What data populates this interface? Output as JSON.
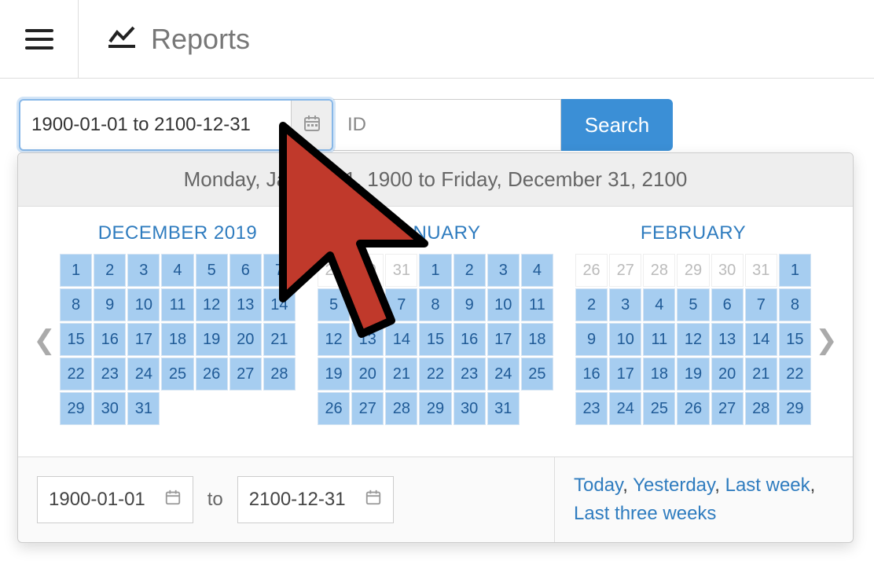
{
  "header": {
    "title": "Reports"
  },
  "search": {
    "daterange_value": "1900-01-01 to 2100-12-31",
    "id_placeholder": "ID",
    "button_label": "Search"
  },
  "datepicker": {
    "range_text": "Monday, January 1, 1900 to Friday, December 31, 2100",
    "months": [
      {
        "title": "DECEMBER 2019",
        "days": [
          {
            "n": "1",
            "in": true
          },
          {
            "n": "2",
            "in": true
          },
          {
            "n": "3",
            "in": true
          },
          {
            "n": "4",
            "in": true
          },
          {
            "n": "5",
            "in": true
          },
          {
            "n": "6",
            "in": true
          },
          {
            "n": "7",
            "in": true
          },
          {
            "n": "8",
            "in": true
          },
          {
            "n": "9",
            "in": true
          },
          {
            "n": "10",
            "in": true
          },
          {
            "n": "11",
            "in": true
          },
          {
            "n": "12",
            "in": true
          },
          {
            "n": "13",
            "in": true
          },
          {
            "n": "14",
            "in": true
          },
          {
            "n": "15",
            "in": true
          },
          {
            "n": "16",
            "in": true
          },
          {
            "n": "17",
            "in": true
          },
          {
            "n": "18",
            "in": true
          },
          {
            "n": "19",
            "in": true
          },
          {
            "n": "20",
            "in": true
          },
          {
            "n": "21",
            "in": true
          },
          {
            "n": "22",
            "in": true
          },
          {
            "n": "23",
            "in": true
          },
          {
            "n": "24",
            "in": true
          },
          {
            "n": "25",
            "in": true
          },
          {
            "n": "26",
            "in": true
          },
          {
            "n": "27",
            "in": true
          },
          {
            "n": "28",
            "in": true
          },
          {
            "n": "29",
            "in": true
          },
          {
            "n": "30",
            "in": true
          },
          {
            "n": "31",
            "in": true
          }
        ]
      },
      {
        "title": "JANUARY",
        "days": [
          {
            "n": "29",
            "in": false
          },
          {
            "n": "30",
            "in": false
          },
          {
            "n": "31",
            "in": false
          },
          {
            "n": "1",
            "in": true
          },
          {
            "n": "2",
            "in": true
          },
          {
            "n": "3",
            "in": true
          },
          {
            "n": "4",
            "in": true
          },
          {
            "n": "5",
            "in": true
          },
          {
            "n": "6",
            "in": true
          },
          {
            "n": "7",
            "in": true
          },
          {
            "n": "8",
            "in": true
          },
          {
            "n": "9",
            "in": true
          },
          {
            "n": "10",
            "in": true
          },
          {
            "n": "11",
            "in": true
          },
          {
            "n": "12",
            "in": true
          },
          {
            "n": "13",
            "in": true
          },
          {
            "n": "14",
            "in": true
          },
          {
            "n": "15",
            "in": true
          },
          {
            "n": "16",
            "in": true
          },
          {
            "n": "17",
            "in": true
          },
          {
            "n": "18",
            "in": true
          },
          {
            "n": "19",
            "in": true
          },
          {
            "n": "20",
            "in": true
          },
          {
            "n": "21",
            "in": true
          },
          {
            "n": "22",
            "in": true
          },
          {
            "n": "23",
            "in": true
          },
          {
            "n": "24",
            "in": true
          },
          {
            "n": "25",
            "in": true
          },
          {
            "n": "26",
            "in": true
          },
          {
            "n": "27",
            "in": true
          },
          {
            "n": "28",
            "in": true
          },
          {
            "n": "29",
            "in": true
          },
          {
            "n": "30",
            "in": true
          },
          {
            "n": "31",
            "in": true
          }
        ]
      },
      {
        "title": "FEBRUARY",
        "days": [
          {
            "n": "26",
            "in": false
          },
          {
            "n": "27",
            "in": false
          },
          {
            "n": "28",
            "in": false
          },
          {
            "n": "29",
            "in": false
          },
          {
            "n": "30",
            "in": false
          },
          {
            "n": "31",
            "in": false
          },
          {
            "n": "1",
            "in": true
          },
          {
            "n": "2",
            "in": true
          },
          {
            "n": "3",
            "in": true
          },
          {
            "n": "4",
            "in": true
          },
          {
            "n": "5",
            "in": true
          },
          {
            "n": "6",
            "in": true
          },
          {
            "n": "7",
            "in": true
          },
          {
            "n": "8",
            "in": true
          },
          {
            "n": "9",
            "in": true
          },
          {
            "n": "10",
            "in": true
          },
          {
            "n": "11",
            "in": true
          },
          {
            "n": "12",
            "in": true
          },
          {
            "n": "13",
            "in": true
          },
          {
            "n": "14",
            "in": true
          },
          {
            "n": "15",
            "in": true
          },
          {
            "n": "16",
            "in": true
          },
          {
            "n": "17",
            "in": true
          },
          {
            "n": "18",
            "in": true
          },
          {
            "n": "19",
            "in": true
          },
          {
            "n": "20",
            "in": true
          },
          {
            "n": "21",
            "in": true
          },
          {
            "n": "22",
            "in": true
          },
          {
            "n": "23",
            "in": true
          },
          {
            "n": "24",
            "in": true
          },
          {
            "n": "25",
            "in": true
          },
          {
            "n": "26",
            "in": true
          },
          {
            "n": "27",
            "in": true
          },
          {
            "n": "28",
            "in": true
          },
          {
            "n": "29",
            "in": true
          }
        ]
      }
    ],
    "from_value": "1900-01-01",
    "to_label": "to",
    "to_value": "2100-12-31",
    "presets": {
      "today": "Today",
      "yesterday": "Yesterday",
      "last_week": "Last week",
      "last_three_weeks": "Last three weeks"
    }
  }
}
